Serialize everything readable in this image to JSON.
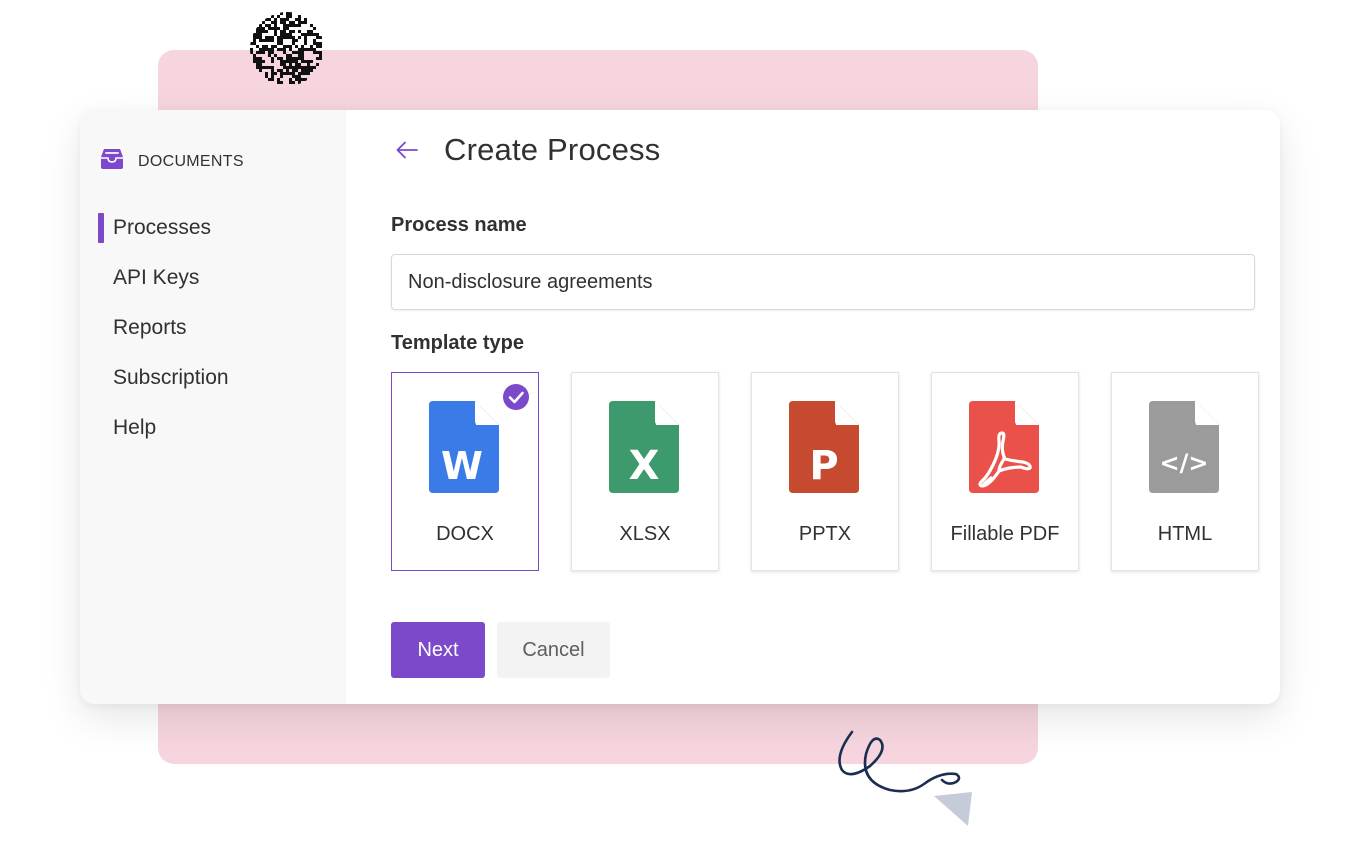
{
  "colors": {
    "accent": "#7b49c9",
    "backdrop_pink": "#f6d5de",
    "sidebar_bg": "#f8f8f8",
    "docx_blue": "#3b7be8",
    "xlsx_green": "#3d9a6c",
    "pptx_red": "#c64a2f",
    "pdf_red": "#e9514a",
    "html_gray": "#9b9b9b",
    "doodle_navy": "#1c2d52",
    "arrow_gray": "#c5cbd8"
  },
  "sidebar": {
    "brand": {
      "icon": "inbox-tray-icon",
      "label": "DOCUMENTS"
    },
    "items": [
      {
        "label": "Processes",
        "active": true
      },
      {
        "label": "API Keys",
        "active": false
      },
      {
        "label": "Reports",
        "active": false
      },
      {
        "label": "Subscription",
        "active": false
      },
      {
        "label": "Help",
        "active": false
      }
    ]
  },
  "header": {
    "back_icon": "arrow-left-icon",
    "title": "Create Process"
  },
  "form": {
    "process_name_label": "Process name",
    "process_name_value": "Non-disclosure agreements",
    "template_type_label": "Template type",
    "selected_template": "DOCX",
    "templates": [
      {
        "label": "DOCX",
        "icon": "word-document-icon",
        "glyph": "W",
        "color": "#3b7be8"
      },
      {
        "label": "XLSX",
        "icon": "excel-spreadsheet-icon",
        "glyph": "X",
        "color": "#3d9a6c"
      },
      {
        "label": "PPTX",
        "icon": "powerpoint-presentation-icon",
        "glyph": "P",
        "color": "#c64a2f"
      },
      {
        "label": "Fillable PDF",
        "icon": "pdf-document-icon",
        "glyph": "",
        "color": "#e9514a"
      },
      {
        "label": "HTML",
        "icon": "html-code-icon",
        "glyph": "</>",
        "color": "#9b9b9b"
      }
    ]
  },
  "actions": {
    "next_label": "Next",
    "cancel_label": "Cancel"
  }
}
